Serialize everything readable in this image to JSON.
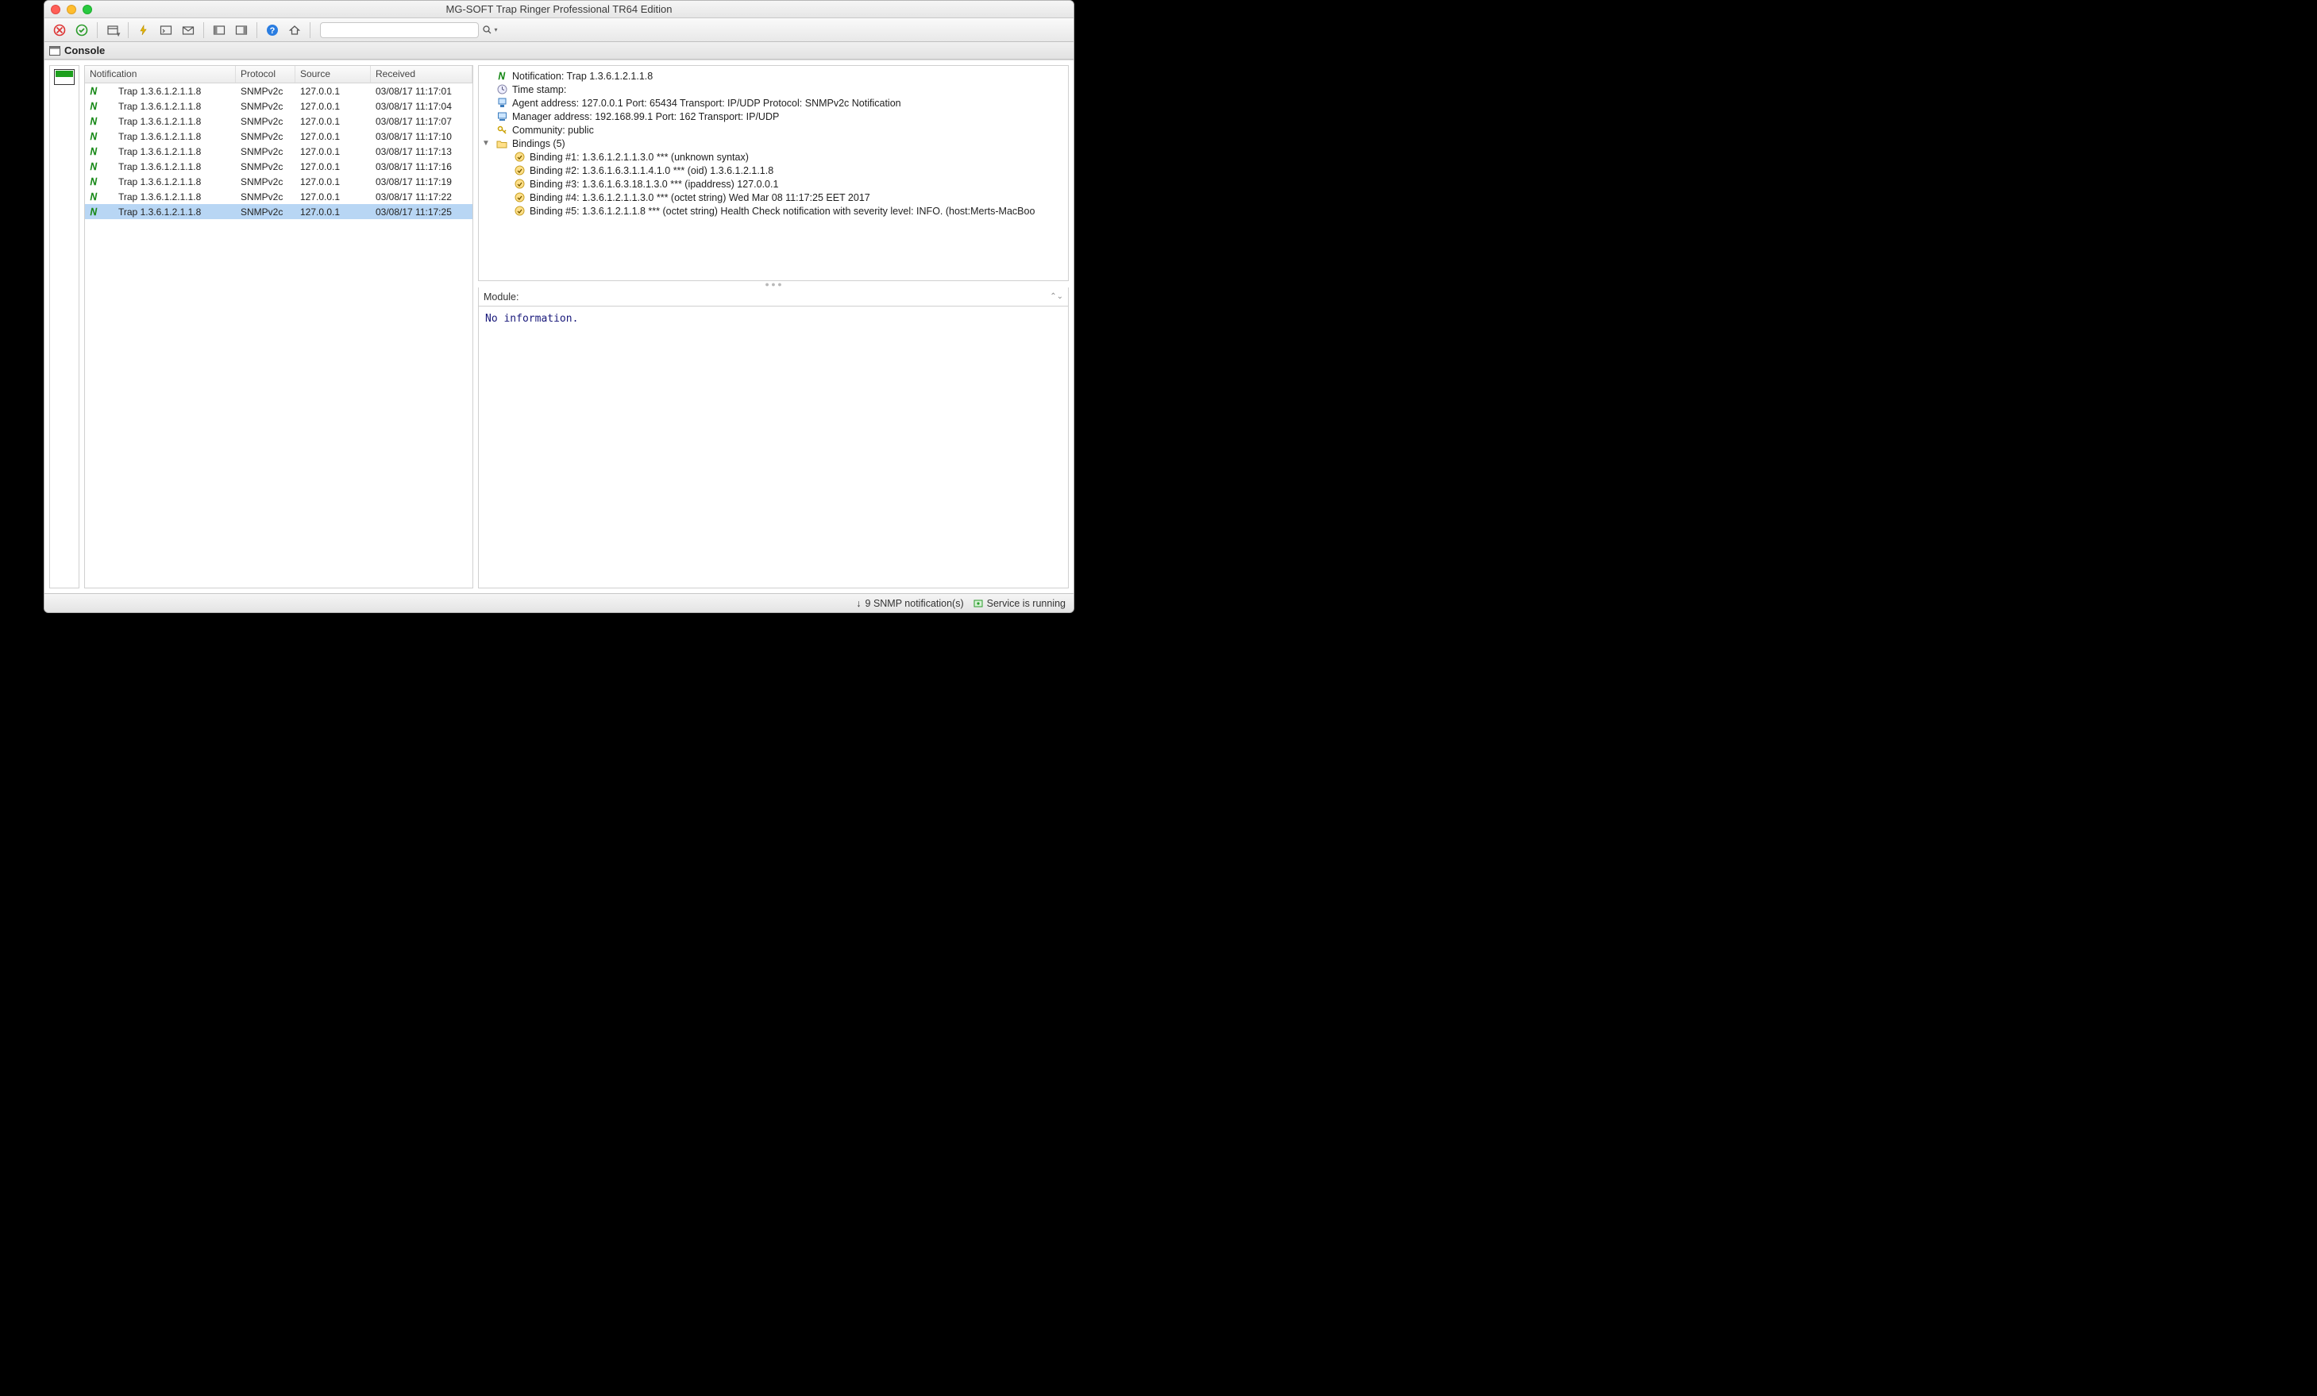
{
  "window": {
    "title": "MG-SOFT Trap Ringer Professional TR64 Edition"
  },
  "panel": {
    "title": "Console"
  },
  "search": {
    "placeholder": ""
  },
  "columns": {
    "notification": "Notification",
    "protocol": "Protocol",
    "source": "Source",
    "received": "Received"
  },
  "rows": [
    {
      "notification": "Trap 1.3.6.1.2.1.1.8",
      "protocol": "SNMPv2c",
      "source": "127.0.0.1",
      "received": "03/08/17 11:17:01",
      "selected": false
    },
    {
      "notification": "Trap 1.3.6.1.2.1.1.8",
      "protocol": "SNMPv2c",
      "source": "127.0.0.1",
      "received": "03/08/17 11:17:04",
      "selected": false
    },
    {
      "notification": "Trap 1.3.6.1.2.1.1.8",
      "protocol": "SNMPv2c",
      "source": "127.0.0.1",
      "received": "03/08/17 11:17:07",
      "selected": false
    },
    {
      "notification": "Trap 1.3.6.1.2.1.1.8",
      "protocol": "SNMPv2c",
      "source": "127.0.0.1",
      "received": "03/08/17 11:17:10",
      "selected": false
    },
    {
      "notification": "Trap 1.3.6.1.2.1.1.8",
      "protocol": "SNMPv2c",
      "source": "127.0.0.1",
      "received": "03/08/17 11:17:13",
      "selected": false
    },
    {
      "notification": "Trap 1.3.6.1.2.1.1.8",
      "protocol": "SNMPv2c",
      "source": "127.0.0.1",
      "received": "03/08/17 11:17:16",
      "selected": false
    },
    {
      "notification": "Trap 1.3.6.1.2.1.1.8",
      "protocol": "SNMPv2c",
      "source": "127.0.0.1",
      "received": "03/08/17 11:17:19",
      "selected": false
    },
    {
      "notification": "Trap 1.3.6.1.2.1.1.8",
      "protocol": "SNMPv2c",
      "source": "127.0.0.1",
      "received": "03/08/17 11:17:22",
      "selected": false
    },
    {
      "notification": "Trap 1.3.6.1.2.1.1.8",
      "protocol": "SNMPv2c",
      "source": "127.0.0.1",
      "received": "03/08/17 11:17:25",
      "selected": true
    }
  ],
  "detail": {
    "notification": "Notification: Trap 1.3.6.1.2.1.1.8",
    "timestamp": "Time stamp:",
    "agent": "Agent address: 127.0.0.1 Port: 65434 Transport: IP/UDP Protocol: SNMPv2c Notification",
    "manager": "Manager address: 192.168.99.1 Port: 162 Transport: IP/UDP",
    "community": "Community: public",
    "bindings_hdr": "Bindings (5)",
    "bindings": [
      "Binding #1: 1.3.6.1.2.1.1.3.0 *** (unknown syntax)",
      "Binding #2: 1.3.6.1.6.3.1.1.4.1.0 *** (oid) 1.3.6.1.2.1.1.8",
      "Binding #3: 1.3.6.1.6.3.18.1.3.0 *** (ipaddress) 127.0.0.1",
      "Binding #4: 1.3.6.1.2.1.1.3.0 *** (octet string) Wed Mar 08 11:17:25 EET 2017",
      "Binding #5: 1.3.6.1.2.1.1.8 *** (octet string) Health Check notification with severity level: INFO. (host:Merts-MacBoo"
    ]
  },
  "module": {
    "label": "Module:"
  },
  "info": {
    "text": "No information."
  },
  "statusbar": {
    "notifications": "9 SNMP notification(s)",
    "service": "Service is running"
  }
}
